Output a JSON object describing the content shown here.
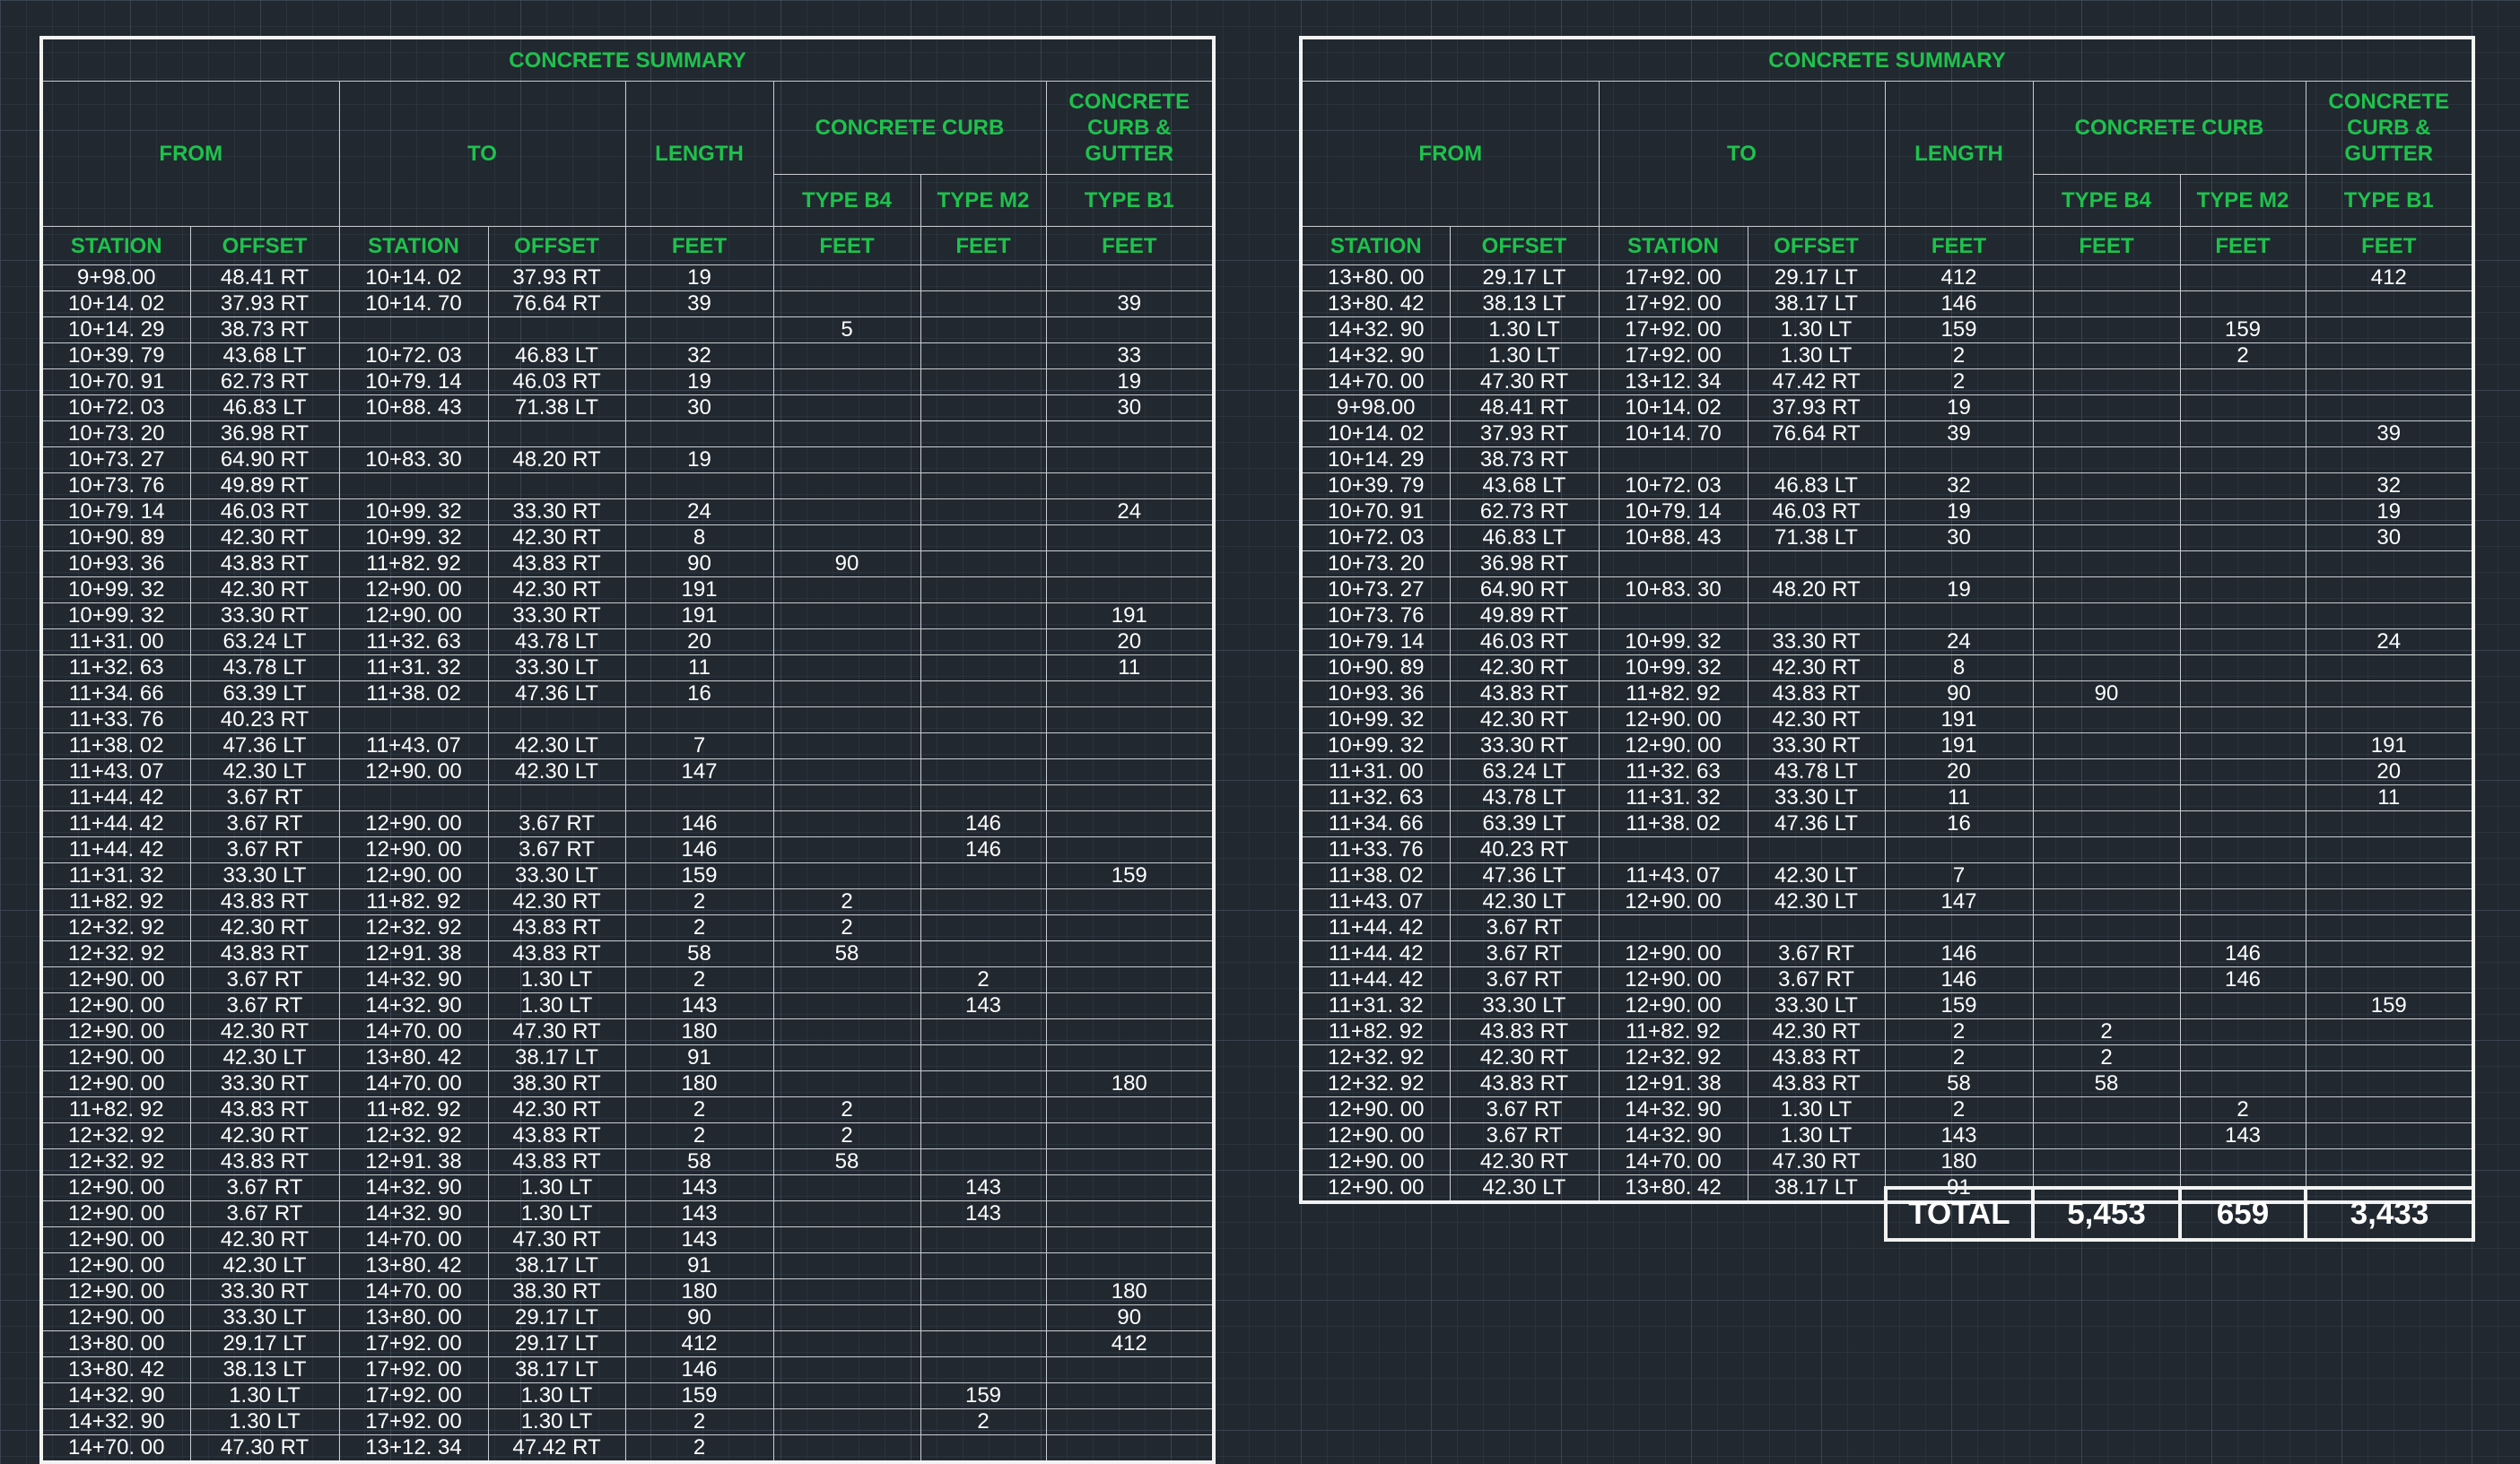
{
  "tables": [
    {
      "title": "CONCRETE SUMMARY",
      "headers": {
        "from": "FROM",
        "to": "TO",
        "length": "LENGTH",
        "concrete_curb": "CONCRETE CURB",
        "curb_gutter": "CONCRETE CURB & GUTTER",
        "type_b4": "TYPE B4",
        "type_m2": "TYPE M2",
        "type_b1": "TYPE B1",
        "station": "STATION",
        "offset": "OFFSET",
        "feet": "FEET"
      },
      "rows": [
        [
          "9+98.00",
          "48.41 RT",
          "10+14. 02",
          "37.93 RT",
          "19",
          "",
          "",
          ""
        ],
        [
          "10+14. 02",
          "37.93 RT",
          "10+14. 70",
          "76.64 RT",
          "39",
          "",
          "",
          "39"
        ],
        [
          "10+14. 29",
          "38.73 RT",
          "",
          "",
          "",
          "5",
          "",
          ""
        ],
        [
          "10+39. 79",
          "43.68 LT",
          "10+72. 03",
          "46.83 LT",
          "32",
          "",
          "",
          "33"
        ],
        [
          "10+70. 91",
          "62.73 RT",
          "10+79. 14",
          "46.03 RT",
          "19",
          "",
          "",
          "19"
        ],
        [
          "10+72. 03",
          "46.83 LT",
          "10+88. 43",
          "71.38 LT",
          "30",
          "",
          "",
          "30"
        ],
        [
          "10+73. 20",
          "36.98 RT",
          "",
          "",
          "",
          "",
          "",
          ""
        ],
        [
          "10+73. 27",
          "64.90 RT",
          "10+83. 30",
          "48.20 RT",
          "19",
          "",
          "",
          ""
        ],
        [
          "10+73. 76",
          "49.89 RT",
          "",
          "",
          "",
          "",
          "",
          ""
        ],
        [
          "10+79. 14",
          "46.03 RT",
          "10+99. 32",
          "33.30 RT",
          "24",
          "",
          "",
          "24"
        ],
        [
          "10+90. 89",
          "42.30 RT",
          "10+99. 32",
          "42.30 RT",
          "8",
          "",
          "",
          ""
        ],
        [
          "10+93. 36",
          "43.83 RT",
          "11+82. 92",
          "43.83 RT",
          "90",
          "90",
          "",
          ""
        ],
        [
          "10+99. 32",
          "42.30 RT",
          "12+90. 00",
          "42.30 RT",
          "191",
          "",
          "",
          ""
        ],
        [
          "10+99. 32",
          "33.30 RT",
          "12+90. 00",
          "33.30 RT",
          "191",
          "",
          "",
          "191"
        ],
        [
          "11+31. 00",
          "63.24 LT",
          "11+32. 63",
          "43.78 LT",
          "20",
          "",
          "",
          "20"
        ],
        [
          "11+32. 63",
          "43.78 LT",
          "11+31. 32",
          "33.30 LT",
          "11",
          "",
          "",
          "11"
        ],
        [
          "11+34. 66",
          "63.39 LT",
          "11+38. 02",
          "47.36 LT",
          "16",
          "",
          "",
          ""
        ],
        [
          "11+33. 76",
          "40.23 RT",
          "",
          "",
          "",
          "",
          "",
          ""
        ],
        [
          "11+38. 02",
          "47.36 LT",
          "11+43. 07",
          "42.30 LT",
          "7",
          "",
          "",
          ""
        ],
        [
          "11+43. 07",
          "42.30 LT",
          "12+90. 00",
          "42.30 LT",
          "147",
          "",
          "",
          ""
        ],
        [
          "11+44. 42",
          "3.67 RT",
          "",
          "",
          "",
          "",
          "",
          ""
        ],
        [
          "11+44. 42",
          "3.67 RT",
          "12+90. 00",
          "3.67 RT",
          "146",
          "",
          "146",
          ""
        ],
        [
          "11+44. 42",
          "3.67 RT",
          "12+90. 00",
          "3.67 RT",
          "146",
          "",
          "146",
          ""
        ],
        [
          "11+31. 32",
          "33.30 LT",
          "12+90. 00",
          "33.30 LT",
          "159",
          "",
          "",
          "159"
        ],
        [
          "11+82. 92",
          "43.83 RT",
          "11+82. 92",
          "42.30 RT",
          "2",
          "2",
          "",
          ""
        ],
        [
          "12+32. 92",
          "42.30 RT",
          "12+32. 92",
          "43.83 RT",
          "2",
          "2",
          "",
          ""
        ],
        [
          "12+32. 92",
          "43.83 RT",
          "12+91. 38",
          "43.83 RT",
          "58",
          "58",
          "",
          ""
        ],
        [
          "12+90. 00",
          "3.67 RT",
          "14+32. 90",
          "1.30 LT",
          "2",
          "",
          "2",
          ""
        ],
        [
          "12+90. 00",
          "3.67 RT",
          "14+32. 90",
          "1.30 LT",
          "143",
          "",
          "143",
          ""
        ],
        [
          "12+90. 00",
          "42.30 RT",
          "14+70. 00",
          "47.30 RT",
          "180",
          "",
          "",
          ""
        ],
        [
          "12+90. 00",
          "42.30 LT",
          "13+80. 42",
          "38.17 LT",
          "91",
          "",
          "",
          ""
        ],
        [
          "12+90. 00",
          "33.30 RT",
          "14+70. 00",
          "38.30 RT",
          "180",
          "",
          "",
          "180"
        ],
        [
          "11+82. 92",
          "43.83 RT",
          "11+82. 92",
          "42.30 RT",
          "2",
          "2",
          "",
          ""
        ],
        [
          "12+32. 92",
          "42.30 RT",
          "12+32. 92",
          "43.83 RT",
          "2",
          "2",
          "",
          ""
        ],
        [
          "12+32. 92",
          "43.83 RT",
          "12+91. 38",
          "43.83 RT",
          "58",
          "58",
          "",
          ""
        ],
        [
          "12+90. 00",
          "3.67 RT",
          "14+32. 90",
          "1.30 LT",
          "143",
          "",
          "143",
          ""
        ],
        [
          "12+90. 00",
          "3.67 RT",
          "14+32. 90",
          "1.30 LT",
          "143",
          "",
          "143",
          ""
        ],
        [
          "12+90. 00",
          "42.30 RT",
          "14+70. 00",
          "47.30 RT",
          "143",
          "",
          "",
          ""
        ],
        [
          "12+90. 00",
          "42.30 LT",
          "13+80. 42",
          "38.17 LT",
          "91",
          "",
          "",
          ""
        ],
        [
          "12+90. 00",
          "33.30 RT",
          "14+70. 00",
          "38.30 RT",
          "180",
          "",
          "",
          "180"
        ],
        [
          "12+90. 00",
          "33.30 LT",
          "13+80. 00",
          "29.17 LT",
          "90",
          "",
          "",
          "90"
        ],
        [
          "13+80. 00",
          "29.17 LT",
          "17+92. 00",
          "29.17 LT",
          "412",
          "",
          "",
          "412"
        ],
        [
          "13+80. 42",
          "38.13 LT",
          "17+92. 00",
          "38.17 LT",
          "146",
          "",
          "",
          ""
        ],
        [
          "14+32. 90",
          "1.30 LT",
          "17+92. 00",
          "1.30 LT",
          "159",
          "",
          "159",
          ""
        ],
        [
          "14+32. 90",
          "1.30 LT",
          "17+92. 00",
          "1.30 LT",
          "2",
          "",
          "2",
          ""
        ],
        [
          "14+70. 00",
          "47.30 RT",
          "13+12. 34",
          "47.42 RT",
          "2",
          "",
          "",
          ""
        ]
      ]
    },
    {
      "title": "CONCRETE SUMMARY",
      "headers": {
        "from": "FROM",
        "to": "TO",
        "length": "LENGTH",
        "concrete_curb": "CONCRETE CURB",
        "curb_gutter": "CONCRETE CURB & GUTTER",
        "type_b4": "TYPE B4",
        "type_m2": "TYPE M2",
        "type_b1": "TYPE B1",
        "station": "STATION",
        "offset": "OFFSET",
        "feet": "FEET"
      },
      "rows": [
        [
          "13+80. 00",
          "29.17 LT",
          "17+92. 00",
          "29.17 LT",
          "412",
          "",
          "",
          "412"
        ],
        [
          "13+80. 42",
          "38.13 LT",
          "17+92. 00",
          "38.17 LT",
          "146",
          "",
          "",
          ""
        ],
        [
          "14+32. 90",
          "1.30 LT",
          "17+92. 00",
          "1.30 LT",
          "159",
          "",
          "159",
          ""
        ],
        [
          "14+32. 90",
          "1.30 LT",
          "17+92. 00",
          "1.30 LT",
          "2",
          "",
          "2",
          ""
        ],
        [
          "14+70. 00",
          "47.30 RT",
          "13+12. 34",
          "47.42 RT",
          "2",
          "",
          "",
          ""
        ],
        [
          "9+98.00",
          "48.41 RT",
          "10+14. 02",
          "37.93 RT",
          "19",
          "",
          "",
          ""
        ],
        [
          "10+14. 02",
          "37.93 RT",
          "10+14. 70",
          "76.64 RT",
          "39",
          "",
          "",
          "39"
        ],
        [
          "10+14. 29",
          "38.73 RT",
          "",
          "",
          "",
          "",
          "",
          ""
        ],
        [
          "10+39. 79",
          "43.68 LT",
          "10+72. 03",
          "46.83 LT",
          "32",
          "",
          "",
          "32"
        ],
        [
          "10+70. 91",
          "62.73 RT",
          "10+79. 14",
          "46.03 RT",
          "19",
          "",
          "",
          "19"
        ],
        [
          "10+72. 03",
          "46.83 LT",
          "10+88. 43",
          "71.38 LT",
          "30",
          "",
          "",
          "30"
        ],
        [
          "10+73. 20",
          "36.98 RT",
          "",
          "",
          "",
          "",
          "",
          ""
        ],
        [
          "10+73. 27",
          "64.90 RT",
          "10+83. 30",
          "48.20 RT",
          "19",
          "",
          "",
          ""
        ],
        [
          "10+73. 76",
          "49.89 RT",
          "",
          "",
          "",
          "",
          "",
          ""
        ],
        [
          "10+79. 14",
          "46.03 RT",
          "10+99. 32",
          "33.30 RT",
          "24",
          "",
          "",
          "24"
        ],
        [
          "10+90. 89",
          "42.30 RT",
          "10+99. 32",
          "42.30 RT",
          "8",
          "",
          "",
          ""
        ],
        [
          "10+93. 36",
          "43.83 RT",
          "11+82. 92",
          "43.83 RT",
          "90",
          "90",
          "",
          ""
        ],
        [
          "10+99. 32",
          "42.30 RT",
          "12+90. 00",
          "42.30 RT",
          "191",
          "",
          "",
          ""
        ],
        [
          "10+99. 32",
          "33.30 RT",
          "12+90. 00",
          "33.30 RT",
          "191",
          "",
          "",
          "191"
        ],
        [
          "11+31. 00",
          "63.24 LT",
          "11+32. 63",
          "43.78 LT",
          "20",
          "",
          "",
          "20"
        ],
        [
          "11+32. 63",
          "43.78 LT",
          "11+31. 32",
          "33.30 LT",
          "11",
          "",
          "",
          "11"
        ],
        [
          "11+34. 66",
          "63.39 LT",
          "11+38. 02",
          "47.36 LT",
          "16",
          "",
          "",
          ""
        ],
        [
          "11+33. 76",
          "40.23 RT",
          "",
          "",
          "",
          "",
          "",
          ""
        ],
        [
          "11+38. 02",
          "47.36 LT",
          "11+43. 07",
          "42.30 LT",
          "7",
          "",
          "",
          ""
        ],
        [
          "11+43. 07",
          "42.30 LT",
          "12+90. 00",
          "42.30 LT",
          "147",
          "",
          "",
          ""
        ],
        [
          "11+44. 42",
          "3.67 RT",
          "",
          "",
          "",
          "",
          "",
          ""
        ],
        [
          "11+44. 42",
          "3.67 RT",
          "12+90. 00",
          "3.67 RT",
          "146",
          "",
          "146",
          ""
        ],
        [
          "11+44. 42",
          "3.67 RT",
          "12+90. 00",
          "3.67 RT",
          "146",
          "",
          "146",
          ""
        ],
        [
          "11+31. 32",
          "33.30 LT",
          "12+90. 00",
          "33.30 LT",
          "159",
          "",
          "",
          "159"
        ],
        [
          "11+82. 92",
          "43.83 RT",
          "11+82. 92",
          "42.30 RT",
          "2",
          "2",
          "",
          ""
        ],
        [
          "12+32. 92",
          "42.30 RT",
          "12+32. 92",
          "43.83 RT",
          "2",
          "2",
          "",
          ""
        ],
        [
          "12+32. 92",
          "43.83 RT",
          "12+91. 38",
          "43.83 RT",
          "58",
          "58",
          "",
          ""
        ],
        [
          "12+90. 00",
          "3.67 RT",
          "14+32. 90",
          "1.30 LT",
          "2",
          "",
          "2",
          ""
        ],
        [
          "12+90. 00",
          "3.67 RT",
          "14+32. 90",
          "1.30 LT",
          "143",
          "",
          "143",
          ""
        ],
        [
          "12+90. 00",
          "42.30 RT",
          "14+70. 00",
          "47.30 RT",
          "180",
          "",
          "",
          ""
        ],
        [
          "12+90. 00",
          "42.30 LT",
          "13+80. 42",
          "38.17 LT",
          "91",
          "",
          "",
          ""
        ]
      ]
    }
  ],
  "totals": {
    "label": "TOTAL",
    "type_b4": "5,453",
    "type_m2": "659",
    "type_b1": "3,433"
  }
}
